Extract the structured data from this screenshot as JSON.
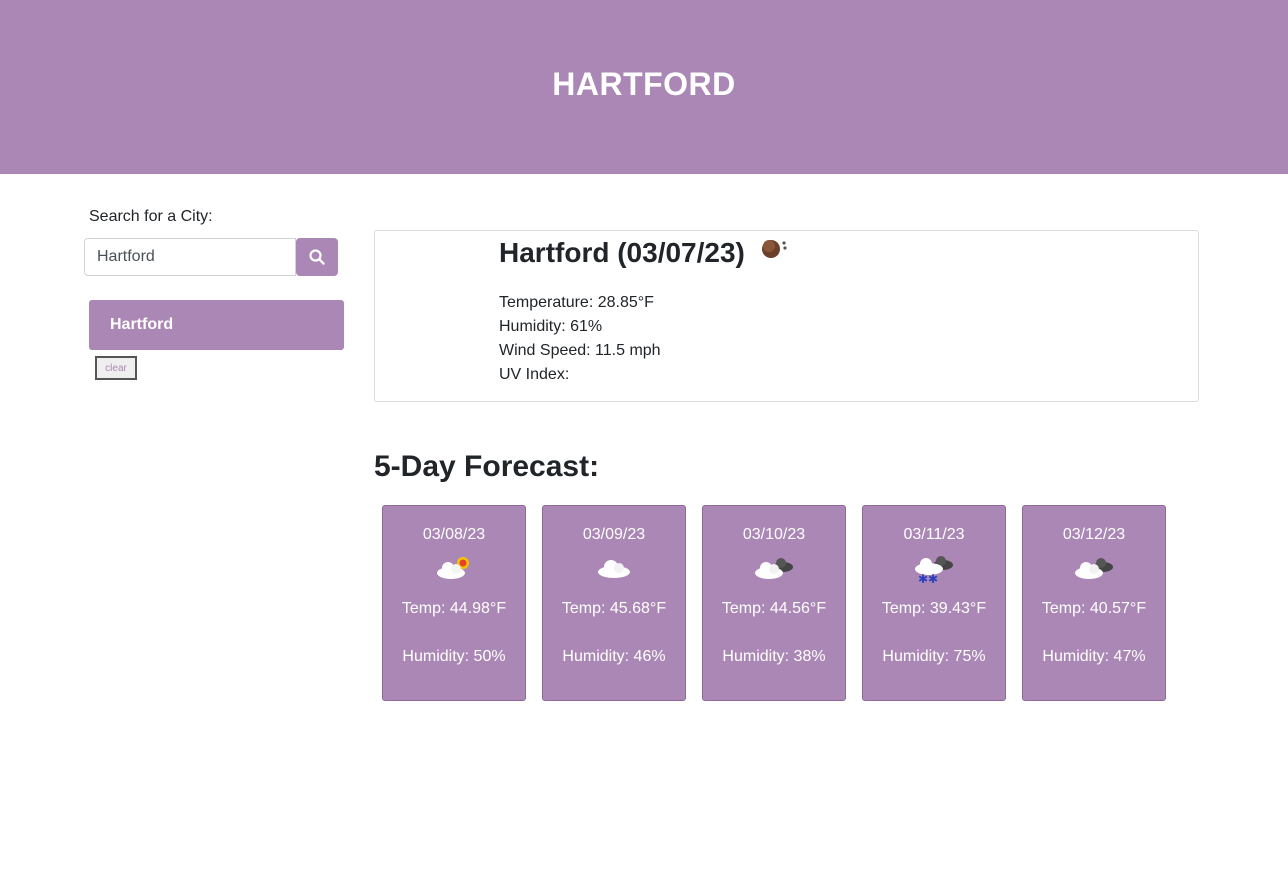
{
  "header": {
    "title": "HARTFORD"
  },
  "sidebar": {
    "search_label": "Search for a City:",
    "search_value": "Hartford",
    "search_icon": "search-icon",
    "history": [
      "Hartford"
    ],
    "clear_label": "clear"
  },
  "current": {
    "title": "Hartford (03/07/23)",
    "icon": "moon-cloud-icon",
    "temperature": "Temperature: 28.85°F",
    "humidity": "Humidity: 61%",
    "wind": "Wind Speed: 11.5 mph",
    "uv": "UV Index:"
  },
  "forecast": {
    "heading": "5-Day Forecast:",
    "days": [
      {
        "date": "03/08/23",
        "icon": "partly-sunny-icon",
        "temp": "Temp: 44.98°F",
        "humidity": "Humidity: 50%"
      },
      {
        "date": "03/09/23",
        "icon": "cloud-icon",
        "temp": "Temp: 45.68°F",
        "humidity": "Humidity: 46%"
      },
      {
        "date": "03/10/23",
        "icon": "broken-clouds-icon",
        "temp": "Temp: 44.56°F",
        "humidity": "Humidity: 38%"
      },
      {
        "date": "03/11/23",
        "icon": "snow-icon",
        "temp": "Temp: 39.43°F",
        "humidity": "Humidity: 75%"
      },
      {
        "date": "03/12/23",
        "icon": "broken-clouds-icon",
        "temp": "Temp: 40.57°F",
        "humidity": "Humidity: 47%"
      }
    ]
  },
  "colors": {
    "accent": "#ab87b5",
    "text": "#212529"
  }
}
